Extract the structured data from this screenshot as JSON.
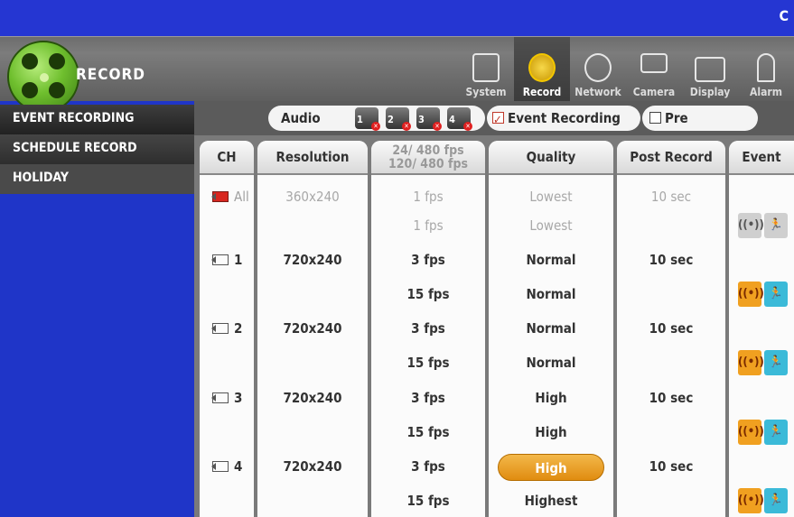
{
  "corner_letter": "C",
  "app": {
    "title": "RECORD"
  },
  "nav": [
    {
      "label": "System",
      "icon": "system-icon",
      "active": false
    },
    {
      "label": "Record",
      "icon": "record-reel-icon",
      "active": true
    },
    {
      "label": "Network",
      "icon": "network-icon",
      "active": false
    },
    {
      "label": "Camera",
      "icon": "camera-icon",
      "active": false
    },
    {
      "label": "Display",
      "icon": "display-icon",
      "active": false
    },
    {
      "label": "Alarm",
      "icon": "alarm-icon",
      "active": false
    }
  ],
  "sidebar": {
    "items": [
      {
        "label": "EVENT RECORDING",
        "active": true
      },
      {
        "label": "SCHEDULE RECORD",
        "active": false
      },
      {
        "label": "HOLIDAY",
        "active": false
      }
    ]
  },
  "toolbar": {
    "audio_label": "Audio",
    "audio_channels": [
      "1",
      "2",
      "3",
      "4"
    ],
    "event_recording_label": "Event Recording",
    "event_recording_checked": true,
    "pre_recording_label": "Pre Recording",
    "pre_recording_checked": false
  },
  "table": {
    "headers": {
      "ch": "CH",
      "resolution": "Resolution",
      "fps_line1": "24/ 480 fps",
      "fps_line2": "120/ 480 fps",
      "quality": "Quality",
      "post_record": "Post Record",
      "event": "Event"
    },
    "all_row": {
      "ch": "All",
      "resolution": "360x240",
      "fps": "1 fps",
      "quality": "Lowest",
      "post_record": "10 sec",
      "fps_event": "1 fps",
      "quality_event": "Lowest"
    },
    "channels": [
      {
        "ch": "1",
        "resolution": "720x240",
        "fps": "3 fps",
        "quality": "Normal",
        "post_record": "10 sec",
        "fps_event": "15 fps",
        "quality_event": "Normal"
      },
      {
        "ch": "2",
        "resolution": "720x240",
        "fps": "3 fps",
        "quality": "Normal",
        "post_record": "10 sec",
        "fps_event": "15 fps",
        "quality_event": "Normal"
      },
      {
        "ch": "3",
        "resolution": "720x240",
        "fps": "3 fps",
        "quality": "High",
        "post_record": "10 sec",
        "fps_event": "15 fps",
        "quality_event": "High"
      },
      {
        "ch": "4",
        "resolution": "720x240",
        "fps": "3 fps",
        "quality": "High",
        "post_record": "10 sec",
        "fps_event": "15 fps",
        "quality_event": "Highest",
        "quality_highlighted": true
      }
    ]
  },
  "colors": {
    "background_blue": "#1f35c8",
    "highlight_orange": "#e08c10",
    "sensor_orange": "#f0a020",
    "motion_cyan": "#3bbad8"
  }
}
